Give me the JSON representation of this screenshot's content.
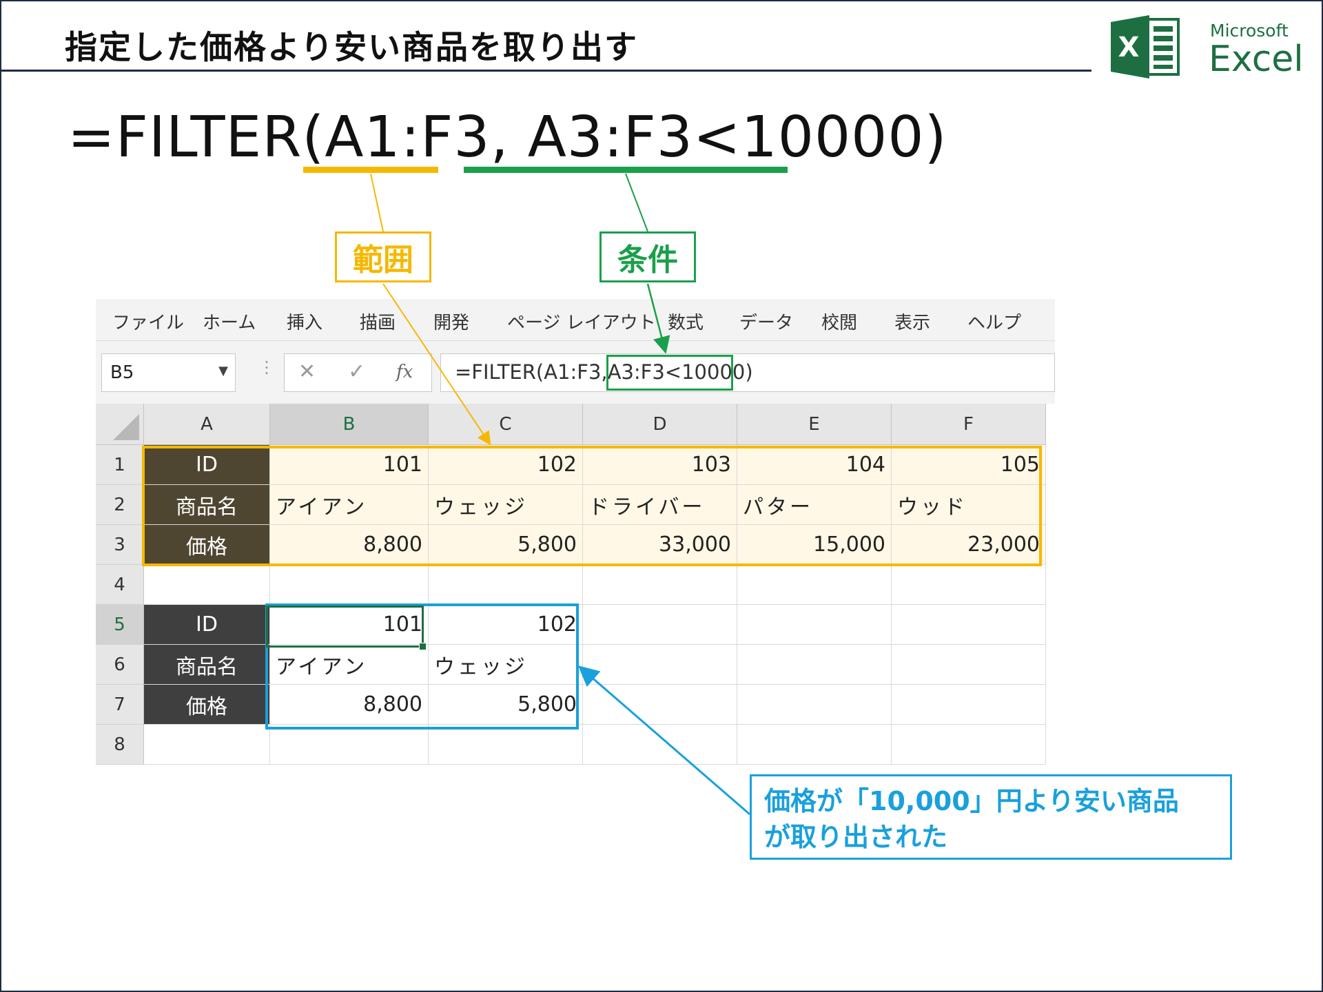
{
  "title": "指定した価格より安い商品を取り出す",
  "logo": {
    "icon": "excel-logo-icon",
    "word1": "Microsoft",
    "word2": "Excel",
    "letter": "X"
  },
  "formula": {
    "prefix": "=FILTER(",
    "range_arg": "A1:F3",
    "separator": ", ",
    "condition_arg": "A3:F3<10000",
    "suffix": ")"
  },
  "labels": {
    "range": "範囲",
    "condition": "条件"
  },
  "ribbon": [
    "ファイル",
    "ホーム",
    "挿入",
    "描画",
    "開発",
    "ページ レイアウト",
    "数式",
    "データ",
    "校閲",
    "表示",
    "ヘルプ"
  ],
  "formula_bar": {
    "name_box": "B5",
    "cancel": "✕",
    "enter": "✓",
    "fx": "fx",
    "text": "=FILTER(A1:F3,A3:F3<10000)"
  },
  "columns": [
    "A",
    "B",
    "C",
    "D",
    "E",
    "F"
  ],
  "rows": [
    "1",
    "2",
    "3",
    "4",
    "5",
    "6",
    "7",
    "8"
  ],
  "source_table": {
    "row_labels": [
      "ID",
      "商品名",
      "価格"
    ],
    "ids": [
      "101",
      "102",
      "103",
      "104",
      "105"
    ],
    "names": [
      "アイアン",
      "ウェッジ",
      "ドライバー",
      "パター",
      "ウッド"
    ],
    "prices": [
      "8,800",
      "5,800",
      "33,000",
      "15,000",
      "23,000"
    ]
  },
  "result_table": {
    "row_labels": [
      "ID",
      "商品名",
      "価格"
    ],
    "ids": [
      "101",
      "102"
    ],
    "names": [
      "アイアン",
      "ウェッジ"
    ],
    "prices": [
      "8,800",
      "5,800"
    ]
  },
  "note": {
    "line1": "価格が「10,000」円より安い商品",
    "line2": "が取り出された"
  },
  "colors": {
    "range": "#f5b800",
    "condition": "#1aa04a",
    "result": "#1aa0dc",
    "excel_green": "#1d6f42"
  }
}
